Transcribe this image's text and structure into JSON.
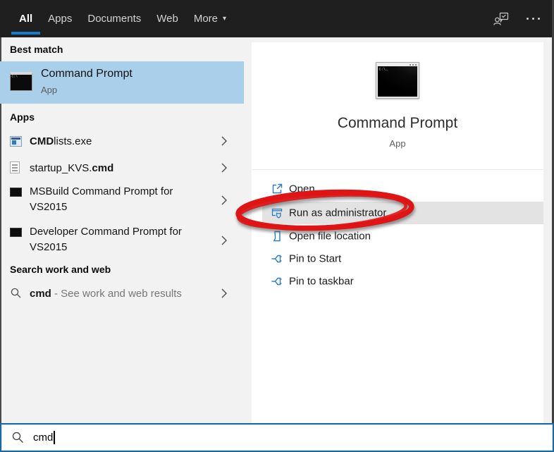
{
  "topbar": {
    "tabs": [
      {
        "label": "All",
        "active": true
      },
      {
        "label": "Apps",
        "active": false
      },
      {
        "label": "Documents",
        "active": false
      },
      {
        "label": "Web",
        "active": false
      },
      {
        "label": "More",
        "active": false,
        "has_dropdown": true
      }
    ],
    "more_arrow": "▾"
  },
  "sidebar": {
    "best_match": {
      "header": "Best match",
      "item": {
        "title": "Command Prompt",
        "subtitle": "App",
        "icon_glyph": "C:\\"
      }
    },
    "apps": {
      "header": "Apps",
      "items": [
        {
          "runs": [
            {
              "t": "CMD",
              "bold": true
            },
            {
              "t": "lists.exe",
              "bold": false
            }
          ],
          "icon": "exe-window-icon"
        },
        {
          "runs": [
            {
              "t": "startup_KVS.",
              "bold": false
            },
            {
              "t": "cmd",
              "bold": true
            }
          ],
          "icon": "document-icon"
        },
        {
          "runs": [
            {
              "t": "MSBuild Command Prompt for VS2015",
              "bold": false
            }
          ],
          "icon": "terminal-icon"
        },
        {
          "runs": [
            {
              "t": "Developer Command Prompt for VS2015",
              "bold": false
            }
          ],
          "icon": "terminal-icon"
        }
      ]
    },
    "search_web": {
      "header": "Search work and web",
      "item": {
        "query": "cmd",
        "suffix": " - See work and web results"
      }
    }
  },
  "detail": {
    "title": "Command Prompt",
    "subtitle": "App",
    "icon_glyph": "C:\\_",
    "actions": [
      {
        "label": "Open",
        "icon": "open-icon",
        "highlighted": false
      },
      {
        "label": "Run as administrator",
        "icon": "admin-shield-icon",
        "highlighted": true,
        "annotated": true
      },
      {
        "label": "Open file location",
        "icon": "file-location-icon",
        "highlighted": false
      },
      {
        "label": "Pin to Start",
        "icon": "pin-icon",
        "highlighted": false
      },
      {
        "label": "Pin to taskbar",
        "icon": "pin-icon",
        "highlighted": false
      }
    ]
  },
  "search_bar": {
    "value": "cmd"
  },
  "colors": {
    "accent_blue": "#1979ca",
    "best_match_highlight": "#a9cfeb",
    "action_icon_blue": "#2b7cc0",
    "annotation_red": "#e01414",
    "search_border_blue": "#1e689e"
  }
}
